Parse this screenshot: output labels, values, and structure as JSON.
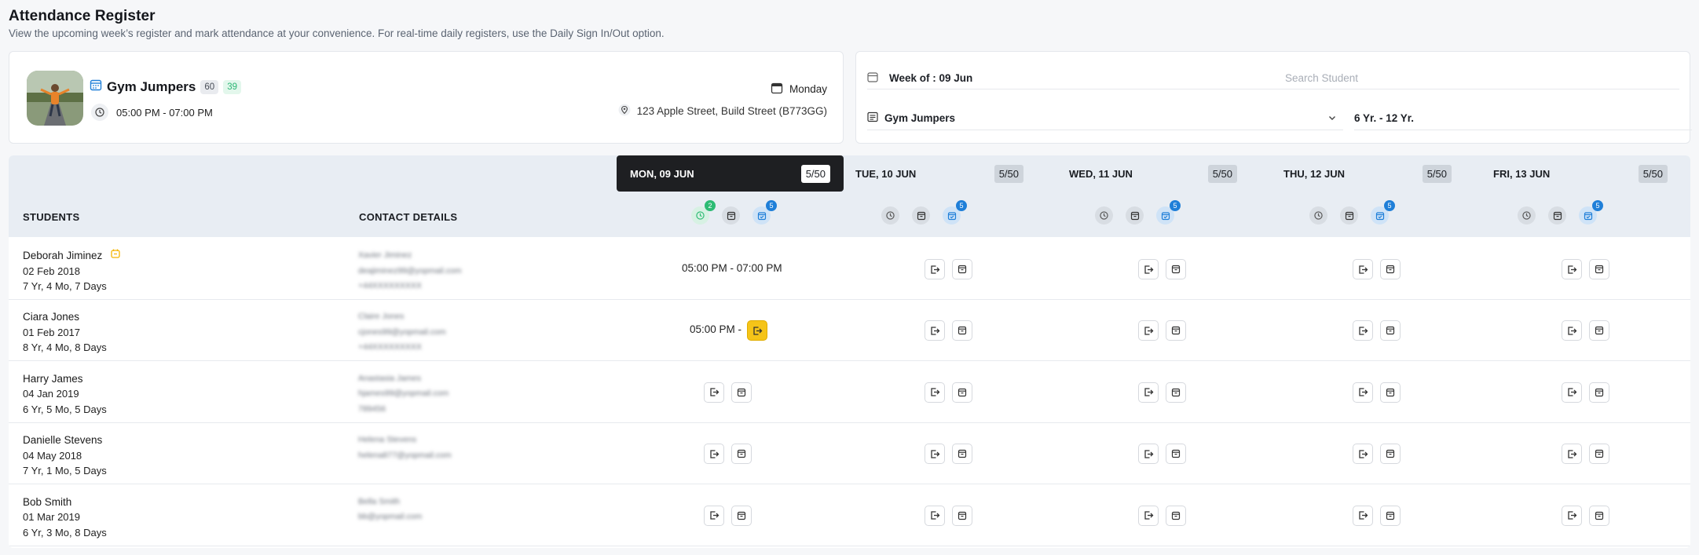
{
  "page": {
    "title": "Attendance Register",
    "subtitle": "View the upcoming week’s register and mark attendance at your convenience. For real-time daily registers, use the Daily Sign In/Out option."
  },
  "class_info": {
    "name": "Gym Jumpers",
    "count_total": "60",
    "count_green": "39",
    "time": "05:00 PM - 07:00 PM",
    "day": "Monday",
    "address": "123 Apple Street, Build Street (B773GG)"
  },
  "filters": {
    "week_label": "Week of : 09 Jun",
    "search_placeholder": "Search Student",
    "class_selected": "Gym Jumpers",
    "age_range": "6 Yr. - 12 Yr."
  },
  "table": {
    "students_header": "STUDENTS",
    "contact_header": "CONTACT DETAILS",
    "days": [
      {
        "label": "MON, 09 JUN",
        "capacity": "5/50",
        "active": true,
        "clock_badge": "2",
        "cal_badge": "5"
      },
      {
        "label": "TUE, 10 JUN",
        "capacity": "5/50",
        "active": false,
        "clock_badge": "",
        "cal_badge": "5"
      },
      {
        "label": "WED, 11 JUN",
        "capacity": "5/50",
        "active": false,
        "clock_badge": "",
        "cal_badge": "5"
      },
      {
        "label": "THU, 12 JUN",
        "capacity": "5/50",
        "active": false,
        "clock_badge": "",
        "cal_badge": "5"
      },
      {
        "label": "FRI, 13 JUN",
        "capacity": "5/50",
        "active": false,
        "clock_badge": "",
        "cal_badge": "5"
      }
    ],
    "rows": [
      {
        "name": "Deborah Jiminez",
        "dob": "02 Feb 2018",
        "age": "7 Yr, 4 Mo, 7 Days",
        "flag": true,
        "contact": [
          "Xavier Jiminez",
          "deajiminez99@yopmail.com",
          "+44XXXXXXXXX"
        ],
        "mon_text": "05:00 PM - 07:00 PM",
        "mon_mode": "text"
      },
      {
        "name": "Ciara Jones",
        "dob": "01 Feb 2017",
        "age": "8 Yr, 4 Mo, 8 Days",
        "flag": false,
        "contact": [
          "Claire Jones",
          "cjones99@yopmail.com",
          "+44XXXXXXXXX"
        ],
        "mon_text": "05:00 PM -",
        "mon_mode": "signout"
      },
      {
        "name": "Harry James",
        "dob": "04 Jan 2019",
        "age": "6 Yr, 5 Mo, 5 Days",
        "flag": false,
        "contact": [
          "Anastasia James",
          "hjames99@yopmail.com",
          "789456"
        ],
        "mon_text": "",
        "mon_mode": "actions"
      },
      {
        "name": "Danielle Stevens",
        "dob": "04 May 2018",
        "age": "7 Yr, 1 Mo, 5 Days",
        "flag": false,
        "contact": [
          "Helena Stevens",
          "helena877@yopmail.com"
        ],
        "mon_text": "",
        "mon_mode": "actions"
      },
      {
        "name": "Bob Smith",
        "dob": "01 Mar 2019",
        "age": "6 Yr, 3 Mo, 8 Days",
        "flag": false,
        "contact": [
          "Bella Smith",
          "bb@yopmail.com"
        ],
        "mon_text": "",
        "mon_mode": "actions"
      }
    ]
  },
  "colors": {
    "active_day": "#1e1f22",
    "accent_blue": "#1f7fd8",
    "accent_green": "#2dbb74",
    "signout_yellow": "#f5c418"
  }
}
